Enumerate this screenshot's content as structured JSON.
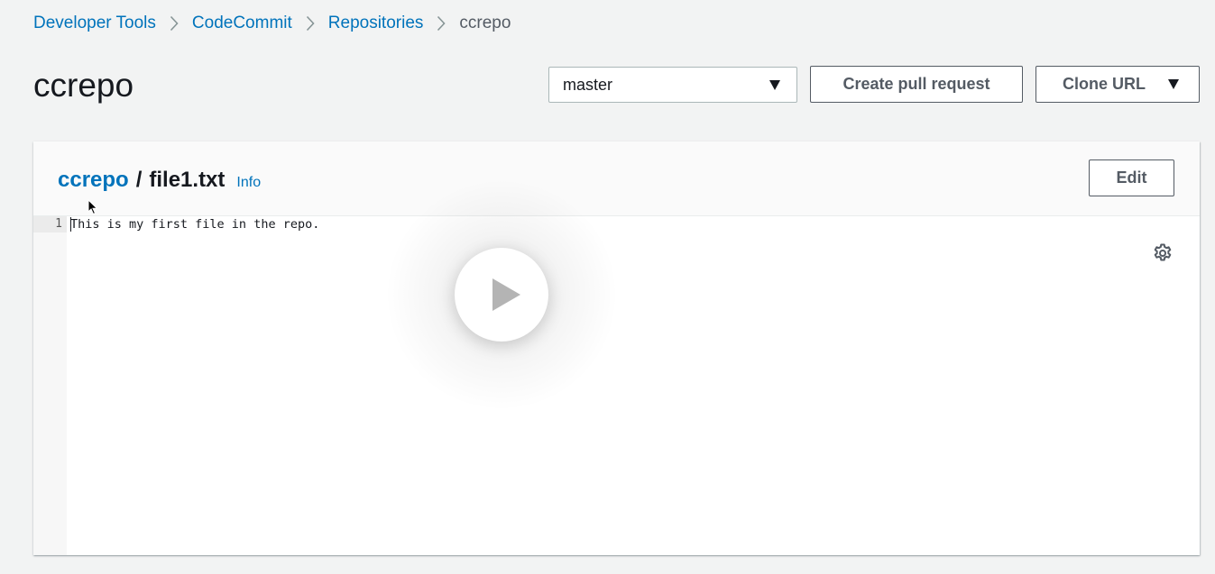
{
  "breadcrumb": {
    "items": [
      {
        "label": "Developer Tools"
      },
      {
        "label": "CodeCommit"
      },
      {
        "label": "Repositories"
      },
      {
        "label": "ccrepo"
      }
    ]
  },
  "page": {
    "title": "ccrepo"
  },
  "header_controls": {
    "branch_selected": "master",
    "create_pull_request_label": "Create pull request",
    "clone_url_label": "Clone URL"
  },
  "file_view": {
    "repo_link": "ccrepo",
    "path_separator": "/",
    "file_name": "file1.txt",
    "info_label": "Info",
    "edit_label": "Edit",
    "lines": [
      {
        "number": "1",
        "text": "This is my first file in the repo."
      }
    ]
  },
  "icons": {
    "breadcrumb_separator": "chevron-right-icon",
    "dropdown": "caret-down-icon",
    "settings": "gear-icon",
    "video": "play-icon",
    "pointer": "mouse-pointer-icon"
  },
  "colors": {
    "link": "#0073bb",
    "page_background": "#f2f3f3",
    "text": "#16191f",
    "button_border": "#545b64"
  }
}
